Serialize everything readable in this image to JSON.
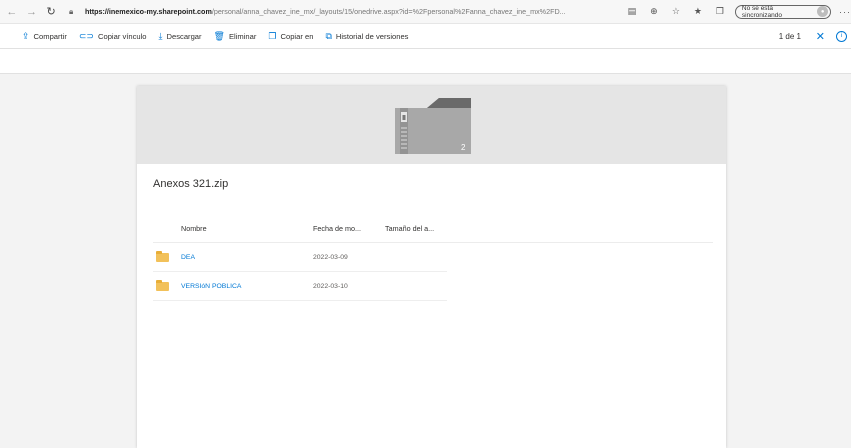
{
  "browser": {
    "address_host": "https://inemexico-my.sharepoint.com",
    "address_path": "/personal/anna_chavez_ine_mx/_layouts/15/onedrive.aspx?id=%2Fpersonal%2Fanna_chavez_ine_mx%2FD...",
    "sync_status": "No se está sincronizando",
    "more": "···"
  },
  "toolbar": {
    "share_label": "Compartir",
    "copy_link_label": "Copiar vínculo",
    "download_label": "Descargar",
    "delete_label": "Eliminar",
    "copy_to_label": "Copiar en",
    "version_history_label": "Historial de versiones",
    "pager": "1 de 1"
  },
  "preview": {
    "file_count": "2"
  },
  "file": {
    "title": "Anexos 321.zip"
  },
  "table": {
    "headers": {
      "name": "Nombre",
      "date": "Fecha de mo...",
      "size": "Tamaño del a..."
    },
    "rows": [
      {
        "name": "DEA",
        "date": "2022-03-09"
      },
      {
        "name": "VERSIóN POBLICA",
        "date": "2022-03-10"
      }
    ]
  },
  "colors": {
    "accent": "#0078d4",
    "folder": "#f2c15a",
    "background": "#f3f3f3"
  }
}
